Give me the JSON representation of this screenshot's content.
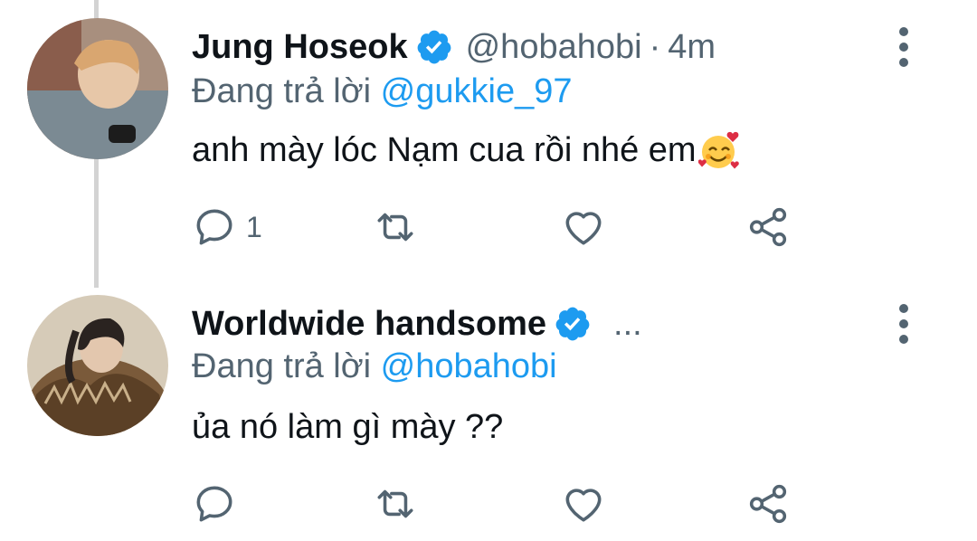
{
  "tweets": [
    {
      "name": "Jung Hoseok",
      "handle": "@hobahobi",
      "separator": "·",
      "time": "4m",
      "reply_prefix": "Đang trả lời",
      "reply_to": "@gukkie_97",
      "text": "anh mày lóc Nạm cua rồi nhé em",
      "emoji": "smiling-face-with-hearts",
      "reply_count": "1",
      "avatar_icon": "avatar-photo"
    },
    {
      "name": "Worldwide handsome",
      "ellipsis": "...",
      "reply_prefix": "Đang trả lời",
      "reply_to": "@hobahobi",
      "text": "ủa nó làm gì mày ??",
      "avatar_icon": "avatar-photo"
    }
  ],
  "colors": {
    "accent": "#1d9bf0",
    "secondary_text": "#536471",
    "primary_text": "#0f1419",
    "thread_line": "#d3d3d3"
  }
}
